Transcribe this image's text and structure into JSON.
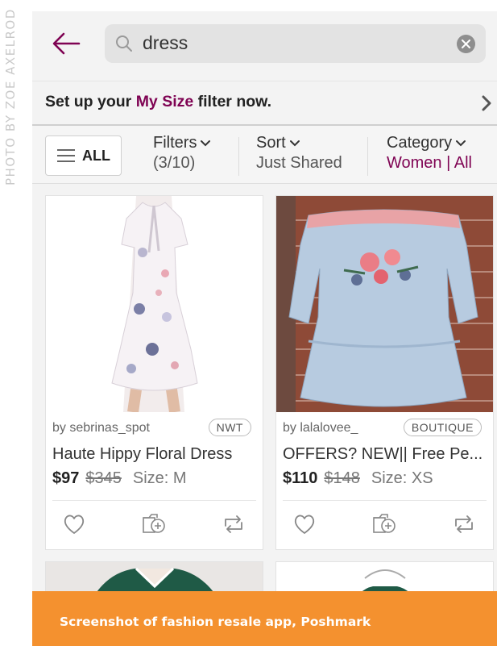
{
  "photo_credit": "PHOTO BY ZOE AXELROD",
  "search": {
    "query": "dress"
  },
  "size_banner": {
    "prefix": "Set up your",
    "highlight": "My Size",
    "suffix": "filter now."
  },
  "filter_bar": {
    "all_label": "ALL",
    "filters": {
      "title": "Filters",
      "value": "(3/10)"
    },
    "sort": {
      "title": "Sort",
      "value": "Just Shared"
    },
    "category": {
      "title": "Category",
      "value": "Women | All"
    }
  },
  "listings": [
    {
      "seller": "by sebrinas_spot",
      "badge": "NWT",
      "title": "Haute Hippy Floral Dress",
      "price": "$97",
      "original_price": "$345",
      "size": "Size: M"
    },
    {
      "seller": "by lalalovee_",
      "badge": "BOUTIQUE",
      "title": "OFFERS? NEW|| Free Pe...",
      "price": "$110",
      "original_price": "$148",
      "size": "Size: XS"
    }
  ],
  "caption": "Screenshot of fashion resale app, Poshmark",
  "colors": {
    "brand": "#7f0353",
    "caption_bg": "#f4912f",
    "background": "#f3f3f3"
  },
  "icons": [
    "back-arrow-icon",
    "search-icon",
    "clear-icon",
    "chevron-right-icon",
    "menu-icon",
    "chevron-down-icon",
    "heart-icon",
    "add-to-bundle-icon",
    "share-icon"
  ]
}
